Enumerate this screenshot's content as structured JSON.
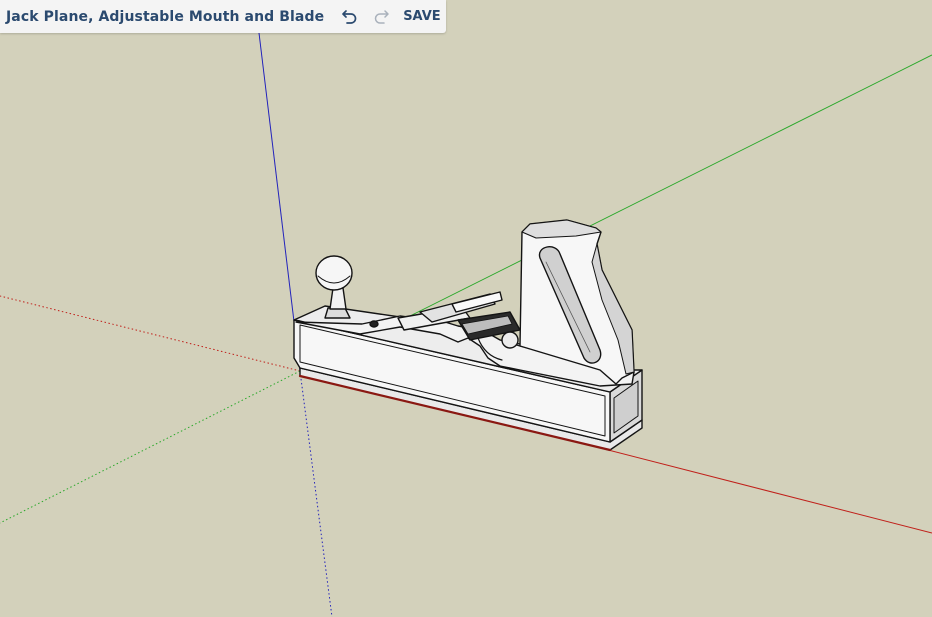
{
  "toolbar": {
    "title": "Jack Plane, Adjustable Mouth and Blade",
    "undo_icon": "undo-icon",
    "redo_icon": "redo-icon",
    "save_label": "SAVE"
  },
  "scene": {
    "background_color": "#d3d1bb",
    "axis_colors": {
      "red": "#c0201a",
      "green": "#2aa82a",
      "blue": "#2222bb"
    },
    "model": "jack-plane"
  }
}
